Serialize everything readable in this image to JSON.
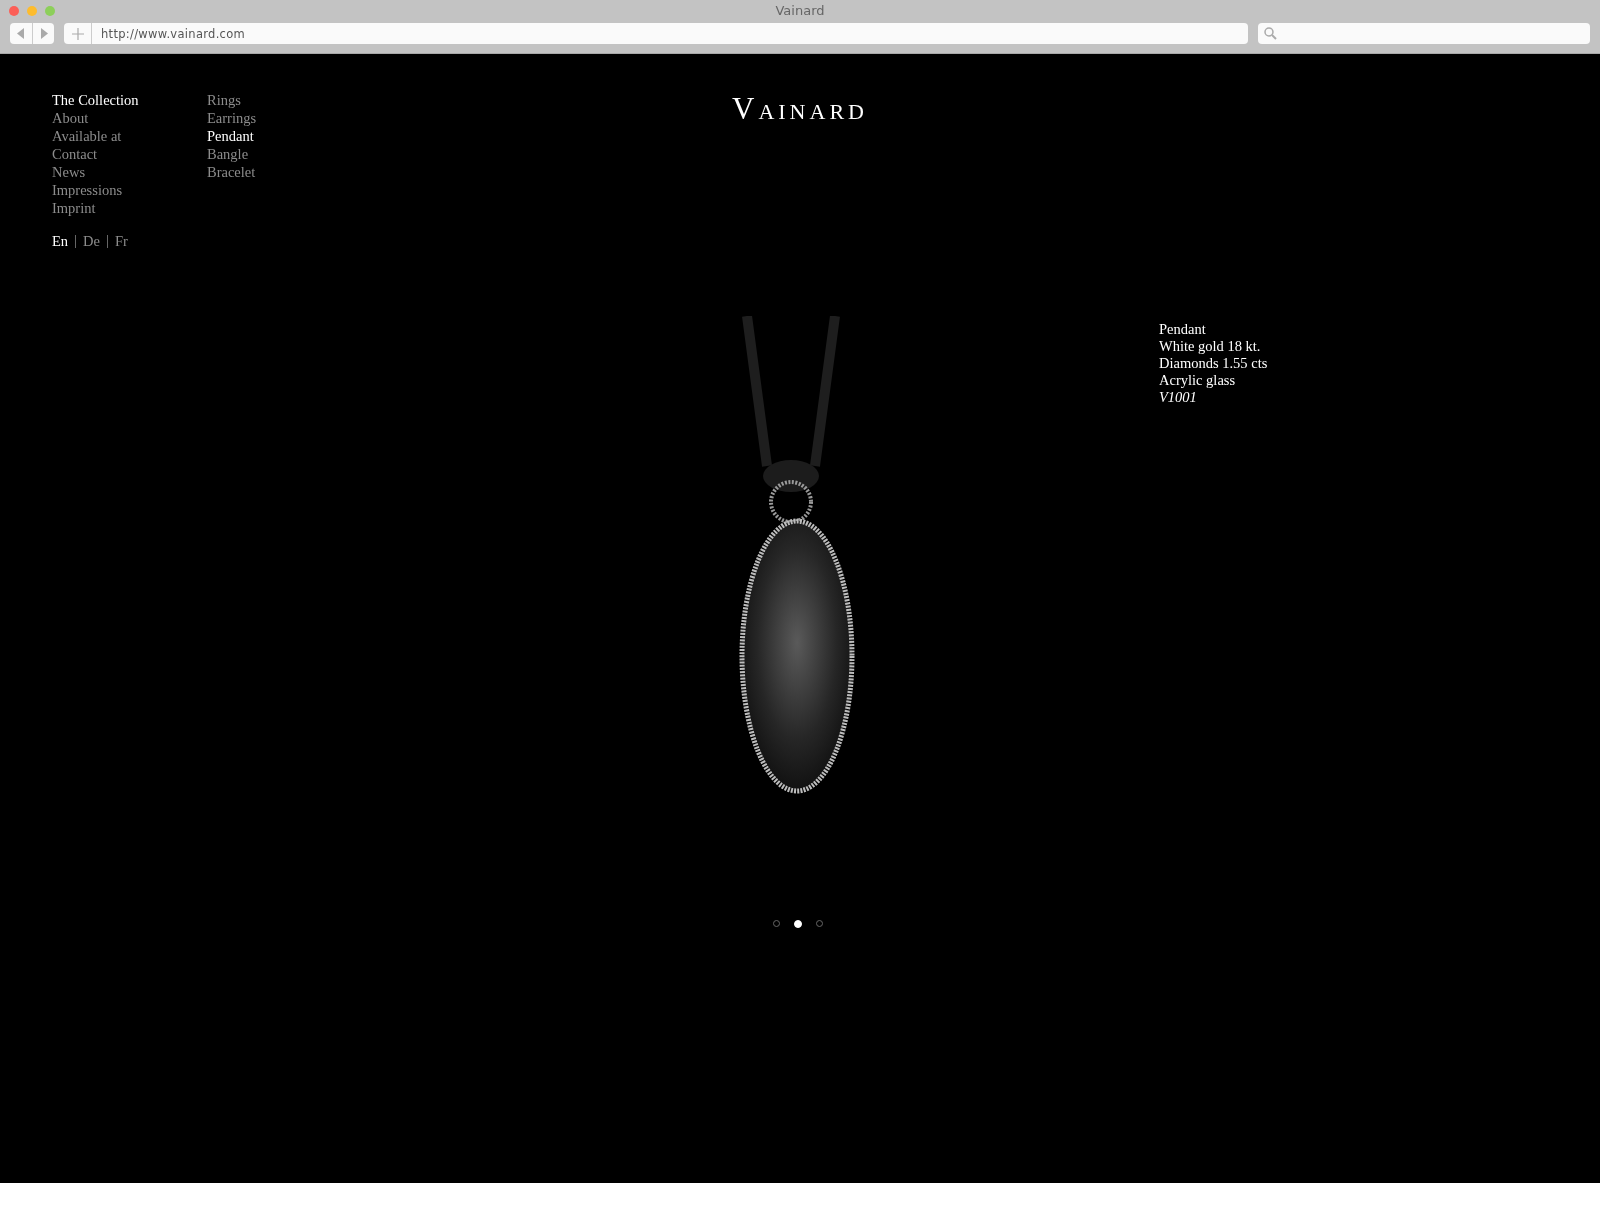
{
  "window": {
    "title": "Vainard",
    "url": "http://www.vainard.com"
  },
  "main_nav": [
    {
      "label": "The Collection",
      "selected": true
    },
    {
      "label": "About",
      "selected": false
    },
    {
      "label": "Available at",
      "selected": false
    },
    {
      "label": "Contact",
      "selected": false
    },
    {
      "label": "News",
      "selected": false
    },
    {
      "label": "Impressions",
      "selected": false
    },
    {
      "label": "Imprint",
      "selected": false
    }
  ],
  "sub_nav": [
    {
      "label": "Rings",
      "selected": false
    },
    {
      "label": "Earrings",
      "selected": false
    },
    {
      "label": "Pendant",
      "selected": true
    },
    {
      "label": "Bangle",
      "selected": false
    },
    {
      "label": "Bracelet",
      "selected": false
    }
  ],
  "languages": [
    {
      "label": "En",
      "selected": true
    },
    {
      "label": "De",
      "selected": false
    },
    {
      "label": "Fr",
      "selected": false
    }
  ],
  "logo": "VAINARD",
  "product": {
    "lines": [
      "Pendant",
      "White gold 18 kt.",
      "Diamonds 1.55 cts",
      "Acrylic glass"
    ],
    "code": "V1001"
  },
  "slides": [
    {
      "selected": false
    },
    {
      "selected": true
    },
    {
      "selected": false
    }
  ]
}
